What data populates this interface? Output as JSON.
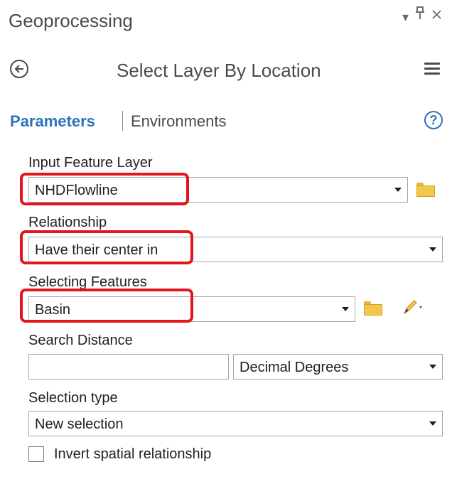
{
  "pane": {
    "title": "Geoprocessing",
    "controls": {
      "dropdown": "▾",
      "pin": "Ҹ",
      "close": "✕"
    }
  },
  "tool": {
    "title": "Select Layer By Location"
  },
  "tabs": {
    "parameters": "Parameters",
    "environments": "Environments",
    "help": "?"
  },
  "params": {
    "input_feature_layer": {
      "label": "Input Feature Layer",
      "value": "NHDFlowline"
    },
    "relationship": {
      "label": "Relationship",
      "value": "Have their center in"
    },
    "selecting_features": {
      "label": "Selecting Features",
      "value": "Basin"
    },
    "search_distance": {
      "label": "Search Distance",
      "value": "",
      "unit": "Decimal Degrees"
    },
    "selection_type": {
      "label": "Selection type",
      "value": "New selection"
    },
    "invert": {
      "label": "Invert spatial relationship",
      "checked": false
    }
  },
  "colors": {
    "accent": "#2d73b9",
    "highlight": "#e3141a",
    "folder": "#f2c84b"
  },
  "icons": [
    "back-arrow-icon",
    "hamburger-menu-icon",
    "help-icon",
    "folder-icon",
    "pencil-icon",
    "chevron-down-icon"
  ]
}
